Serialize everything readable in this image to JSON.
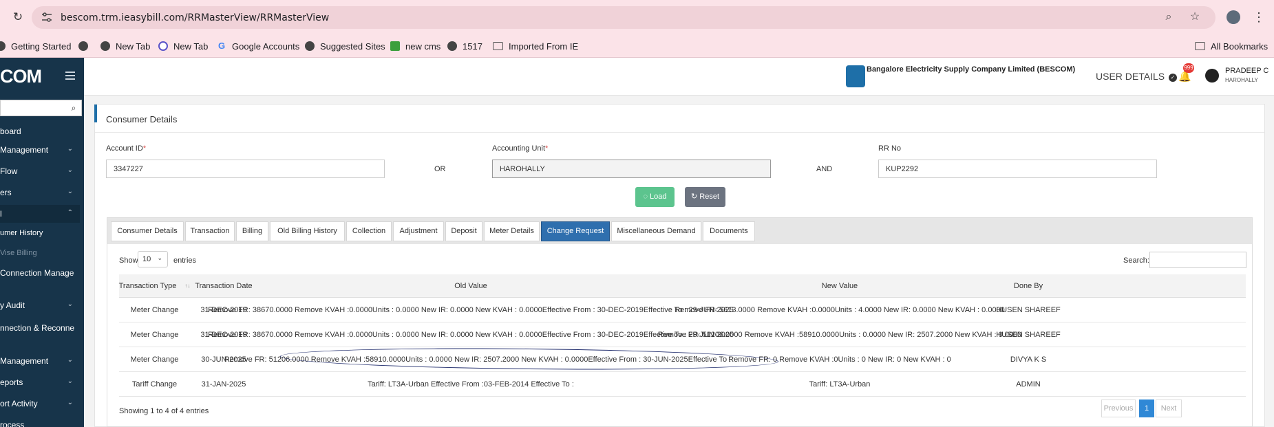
{
  "browser": {
    "url": "bescom.trm.ieasybill.com/RRMasterView/RRMasterView",
    "bookmarks": [
      {
        "label": "Getting Started",
        "icon": "globe-icon"
      },
      {
        "label": "",
        "icon": "globe-icon"
      },
      {
        "label": "New Tab",
        "icon": "globe-icon"
      },
      {
        "label": "New Tab",
        "icon": "tab-icon"
      },
      {
        "label": "Google Accounts",
        "icon": "google-icon"
      },
      {
        "label": "Suggested Sites",
        "icon": "globe-icon"
      },
      {
        "label": "new cms",
        "icon": "cms-icon"
      },
      {
        "label": "1517",
        "icon": "globe-icon"
      },
      {
        "label": "Imported From IE",
        "icon": "folder-icon"
      }
    ],
    "all_bookmarks": "All Bookmarks"
  },
  "app": {
    "logo": "COM",
    "sidebar": {
      "items": [
        "board",
        "Management",
        "Flow",
        "ers",
        "l"
      ],
      "subitems": [
        "umer History",
        "Vise Billing"
      ],
      "items2": [
        "Connection Manage",
        "y Audit",
        "nnection & Reconne",
        "Management",
        "eports",
        "ort Activity",
        "rocess"
      ]
    },
    "org_name": "Bangalore Electricity Supply Company Limited (BESCOM)",
    "user_details_label": "USER DETAILS",
    "notification_count": "999",
    "user_name": "PRADEEP C",
    "user_location": "HAROHALLY"
  },
  "consumer": {
    "title": "Consumer Details",
    "account_id_label": "Account ID",
    "account_id": "3347227",
    "or_label": "OR",
    "accounting_unit_label": "Accounting Unit",
    "accounting_unit": "HAROHALLY",
    "and_label": "AND",
    "rr_no_label": "RR No",
    "rr_no": "KUP2292",
    "load_label": "Load",
    "reset_label": "Reset"
  },
  "tabs": [
    "Consumer Details",
    "Transaction",
    "Billing",
    "Old Billing History",
    "Collection",
    "Adjustment",
    "Deposit",
    "Meter Details",
    "Change Request",
    "Miscellaneous Demand",
    "Documents"
  ],
  "active_tab": "Change Request",
  "table_controls": {
    "show_label": "Show",
    "page_size": "10",
    "entries_label": "entries",
    "search_label": "Search:"
  },
  "table": {
    "headers": [
      "Transaction Type",
      "Transaction Date",
      "Old Value",
      "New Value",
      "Done By"
    ],
    "rows": [
      [
        "Meter Change",
        "31-DEC-2019",
        "Remove FR: 38670.0000 Remove KVAH :0.0000Units : 0.0000 New IR: 0.0000 New KVAH : 0.0000Effective From : 30-DEC-2019Effective To : 29-JUN-2025",
        "Remove FR: 5613.0000 Remove KVAH :0.0000Units : 4.0000 New IR: 0.0000 New KVAH : 0.0000",
        "HUSEN SHAREEF"
      ],
      [
        "Meter Change",
        "31-DEC-2019",
        "Remove FR: 38670.0000 Remove KVAH :0.0000Units : 0.0000 New IR: 0.0000 New KVAH : 0.0000Effective From : 30-DEC-2019Effective To : 29-JUN-2025",
        "Remove FR: 51206.0000 Remove KVAH :58910.0000Units : 0.0000 New IR: 2507.2000 New KVAH : 0.0000",
        "HUSEN SHAREEF"
      ],
      [
        "Meter Change",
        "30-JUN-2025",
        "Remove FR: 51206.0000 Remove KVAH :58910.0000Units : 0.0000 New IR: 2507.2000 New KVAH : 0.0000Effective From : 30-JUN-2025Effective To :",
        "Remove FR: 0 Remove KVAH :0Units : 0 New IR: 0 New KVAH : 0",
        "DIVYA K S"
      ],
      [
        "Tariff Change",
        "31-JAN-2025",
        "Tariff: LT3A-Urban Effective From :03-FEB-2014 Effective To :",
        "Tariff: LT3A-Urban",
        "ADMIN"
      ]
    ]
  },
  "footer": {
    "info": "Showing 1 to 4 of 4 entries",
    "previous": "Previous",
    "page": "1",
    "next": "Next"
  }
}
